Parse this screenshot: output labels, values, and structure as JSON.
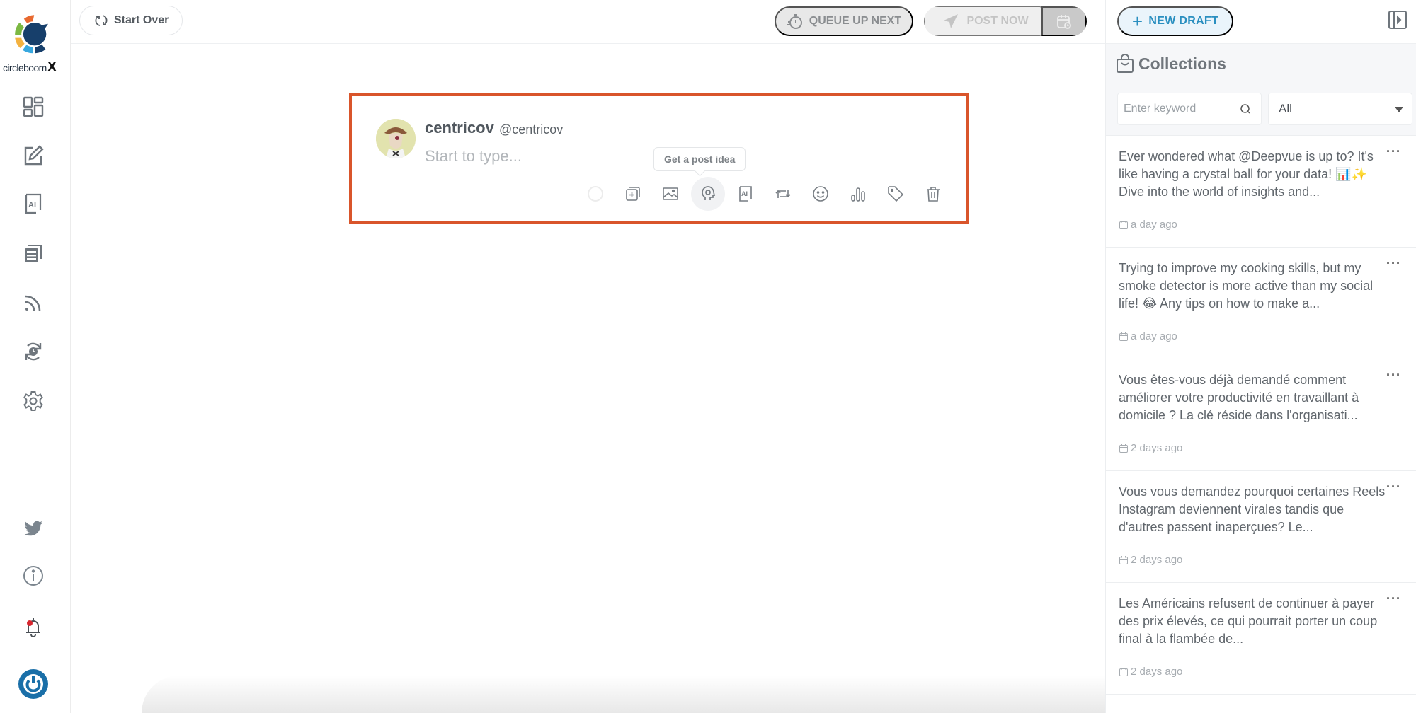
{
  "brand": {
    "name": "circleboom",
    "suffix": "X",
    "accent": "#d9552b",
    "primary": "#1a6fa8"
  },
  "sidebar": {
    "items": [
      {
        "icon": "dashboard-icon",
        "label": "Dashboard"
      },
      {
        "icon": "compose-icon",
        "label": "Compose"
      },
      {
        "icon": "ai-writer-icon",
        "label": "AI Writer"
      },
      {
        "icon": "articles-icon",
        "label": "Articles"
      },
      {
        "icon": "rss-icon",
        "label": "RSS"
      },
      {
        "icon": "auto-schedule-icon",
        "label": "Scheduled"
      },
      {
        "icon": "gear-icon",
        "label": "Settings"
      }
    ],
    "bottom": [
      {
        "icon": "twitter-icon"
      },
      {
        "icon": "info-icon"
      },
      {
        "icon": "notification-bell-icon"
      },
      {
        "icon": "power-icon"
      }
    ]
  },
  "topbar": {
    "start_over": "Start Over",
    "queue_up_next": "QUEUE UP NEXT",
    "post_now": "POST NOW"
  },
  "composer": {
    "user_name": "centricov",
    "user_handle": "@centricov",
    "placeholder": "Start to type...",
    "tooltip": "Get a post idea",
    "tools": [
      "character-count",
      "add-thread",
      "image",
      "post-idea",
      "ai",
      "retweet",
      "emoji",
      "poll",
      "tag",
      "delete"
    ]
  },
  "right_panel": {
    "new_draft": "NEW DRAFT",
    "collections_title": "Collections",
    "keyword_placeholder": "Enter keyword",
    "filter_selected": "All",
    "items": [
      {
        "text": "Ever wondered what @Deepvue is up to? It's like having a crystal ball for your data! 📊✨ Dive into the world of insights and...",
        "date": "a day ago"
      },
      {
        "text": "Trying to improve my cooking skills, but my smoke detector is more active than my social life! 😂 Any tips on how to make a...",
        "date": "a day ago"
      },
      {
        "text": "Vous êtes-vous déjà demandé comment améliorer votre productivité en travaillant à domicile ? La clé réside dans l'organisati...",
        "date": "2 days ago"
      },
      {
        "text": "Vous vous demandez pourquoi certaines Reels Instagram deviennent virales tandis que d'autres passent inaperçues? Le...",
        "date": "2 days ago"
      },
      {
        "text": "Les Américains refusent de continuer à payer des prix élevés, ce qui pourrait porter un coup final à la flambée de...",
        "date": "2 days ago"
      }
    ]
  }
}
